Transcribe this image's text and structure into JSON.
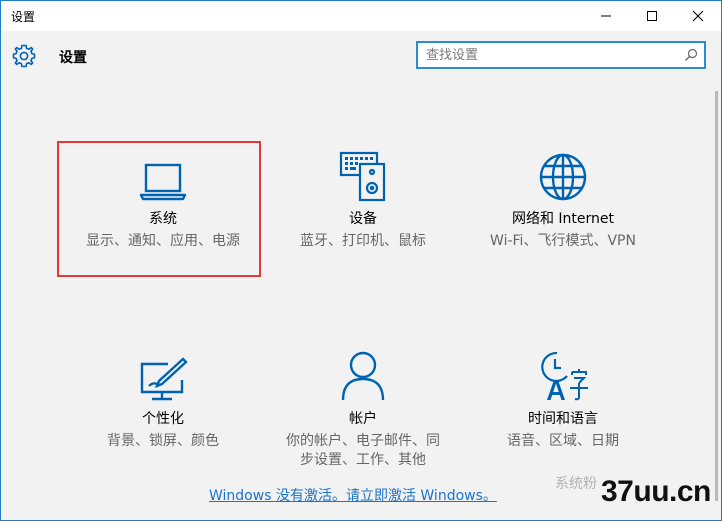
{
  "window": {
    "title": "设置"
  },
  "header": {
    "title": "设置",
    "search_placeholder": "查找设置"
  },
  "tiles": [
    {
      "name": "系统",
      "desc": "显示、通知、应用、电源",
      "icon": "laptop-icon"
    },
    {
      "name": "设备",
      "desc": "蓝牙、打印机、鼠标",
      "icon": "devices-icon"
    },
    {
      "name": "网络和 Internet",
      "desc": "Wi-Fi、飞行模式、VPN",
      "icon": "globe-icon"
    },
    {
      "name": "个性化",
      "desc": "背景、锁屏、颜色",
      "icon": "personalization-icon"
    },
    {
      "name": "帐户",
      "desc": "你的帐户、电子邮件、同步设置、工作、其他",
      "icon": "person-icon"
    },
    {
      "name": "时间和语言",
      "desc": "语音、区域、日期",
      "icon": "time-language-icon"
    }
  ],
  "activation_link": "Windows 没有激活。请立即激活 Windows。",
  "watermark": {
    "text": "37uu.cn",
    "sub": "系统粉"
  },
  "colors": {
    "accent": "#0063b1",
    "highlight": "#e53935",
    "link": "#1a73c8"
  }
}
